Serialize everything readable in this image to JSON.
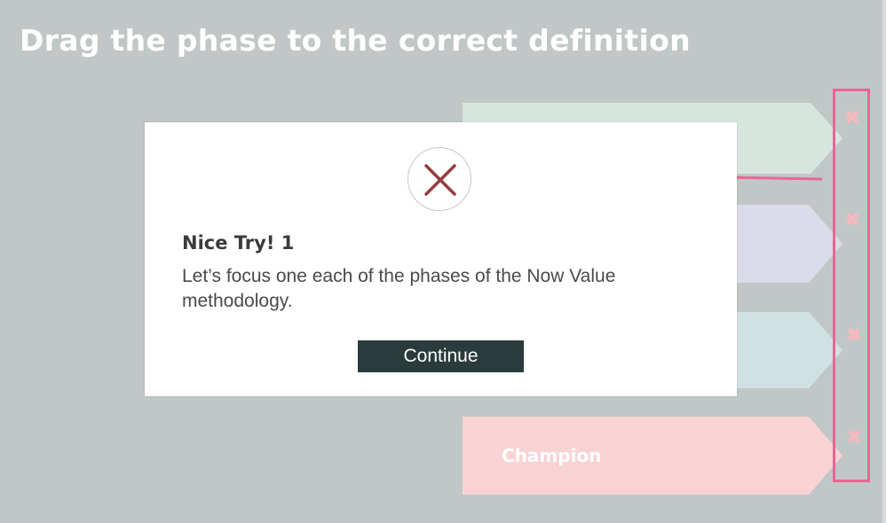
{
  "title": "Drag the phase to the correct definition",
  "phases": [
    {
      "label": "",
      "color": "#d6e6df"
    },
    {
      "label": "",
      "color": "#dcdbe9"
    },
    {
      "label": "",
      "color": "#d0e1e4"
    },
    {
      "label": "Champion",
      "color": "#f9d3d4"
    }
  ],
  "drop_markers": [
    {
      "icon": "close-icon",
      "glyph": "✖"
    },
    {
      "icon": "close-icon",
      "glyph": "✖"
    },
    {
      "icon": "close-icon",
      "glyph": "✖"
    },
    {
      "icon": "close-icon",
      "glyph": "✖"
    }
  ],
  "feedback_modal": {
    "icon": "close-icon",
    "heading": "Nice Try! 1",
    "message": "Let’s focus one each of the phases of the Now Value methodology.",
    "continue_label": "Continue"
  },
  "colors": {
    "background": "#c1c7c7",
    "annotation": "#ea6593",
    "button": "#2a3b3c",
    "error_icon": "#963a3e"
  }
}
